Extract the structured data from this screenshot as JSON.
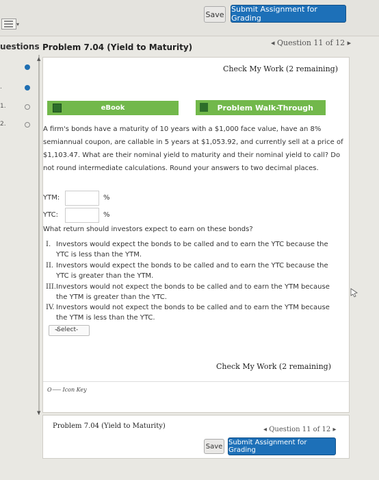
{
  "toolbar": {
    "save": "Save",
    "submit": "Submit Assignment for Grading"
  },
  "header": {
    "questions_tab": "uestions",
    "problem_title": "Problem 7.04 (Yield to Maturity)",
    "question_nav": "◂ Question 11 of 12 ▸"
  },
  "sidebar": {
    "items": [
      {
        "num": "",
        "status": "answered"
      },
      {
        "num": ".",
        "status": "answered"
      },
      {
        "num": "1.",
        "status": "open"
      },
      {
        "num": "2.",
        "status": "open"
      }
    ]
  },
  "panel": {
    "check_top": "Check My Work (2 remaining)",
    "ebook": "eBook",
    "walk": "Problem Walk-Through",
    "question_text": "A firm's bonds have a maturity of 10 years with a $1,000 face value, have an 8% semiannual coupon, are callable in 5 years at $1,053.92, and currently sell at a price of $1,103.47. What are their nominal yield to maturity and their nominal yield to call? Do not round intermediate calculations. Round your answers to two decimal places.",
    "ytm_label": "YTM:",
    "ytc_label": "YTC:",
    "unit": "%",
    "question2": "What return should investors expect to earn on these bonds?",
    "options": [
      {
        "num": "I.",
        "text": "Investors would expect the bonds to be called and to earn the YTC because the YTC is less than the YTM."
      },
      {
        "num": "II.",
        "text": "Investors would expect the bonds to be called and to earn the YTC because the YTC is greater than the YTM."
      },
      {
        "num": "III.",
        "text": "Investors would not expect the bonds to be called and to earn the YTM because the YTM is greater than the YTC."
      },
      {
        "num": "IV.",
        "text": "Investors would not expect the bonds to be called and to earn the YTM because the YTM is less than the YTC."
      }
    ],
    "select_label": "-Select-",
    "check_bottom": "Check My Work (2 remaining)",
    "icon_key": "Icon Key"
  },
  "footer": {
    "title": "Problem 7.04 (Yield to Maturity)",
    "question_nav": "◂ Question 11 of 12 ▸",
    "save": "Save",
    "submit": "Submit Assignment for Grading"
  }
}
